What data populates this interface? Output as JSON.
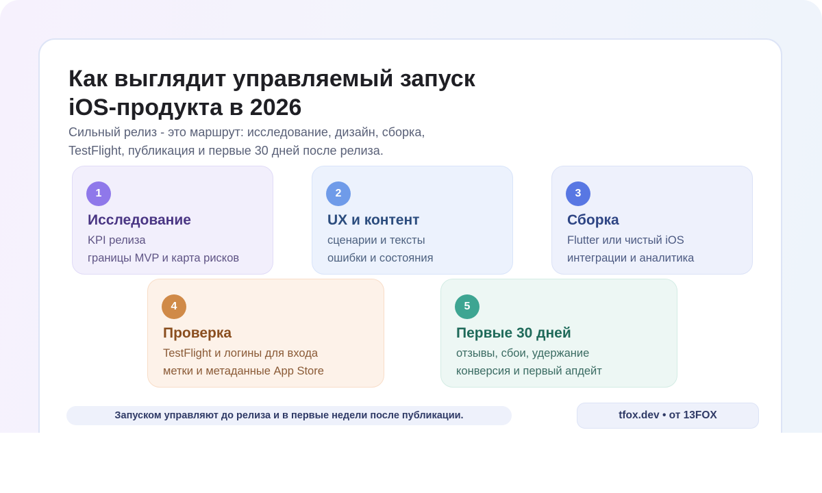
{
  "header": {
    "title_lines": [
      "Как выглядит управляемый запуск",
      "iOS-продукта в 2026"
    ],
    "subtitle_lines": [
      "Сильный релиз - это маршрут: исследование, дизайн, сборка,",
      "TestFlight, публикация и первые 30 дней после релиза."
    ]
  },
  "steps": [
    {
      "number": "1",
      "name": "Исследование",
      "lines": [
        "KPI релиза",
        "границы MVP и карта рисков"
      ],
      "accent": "#8f78ea"
    },
    {
      "number": "2",
      "name": "UX и контент",
      "lines": [
        "сценарии и тексты",
        "ошибки и состояния"
      ],
      "accent": "#6f9be9"
    },
    {
      "number": "3",
      "name": "Сборка",
      "lines": [
        "Flutter или чистый iOS",
        "интеграции и аналитика"
      ],
      "accent": "#5877e3"
    },
    {
      "number": "4",
      "name": "Проверка",
      "lines": [
        "TestFlight и логины для входа",
        "метки и метаданные App Store"
      ],
      "accent": "#d08a48"
    },
    {
      "number": "5",
      "name": "Первые 30 дней",
      "lines": [
        "отзывы, сбои, удержание",
        "конверсия и первый апдейт"
      ],
      "accent": "#3ea592"
    }
  ],
  "footer": {
    "note": "Запуском управляют до релиза и в первые недели после публикации.",
    "brand": "tfox.dev • от 13FOX"
  }
}
